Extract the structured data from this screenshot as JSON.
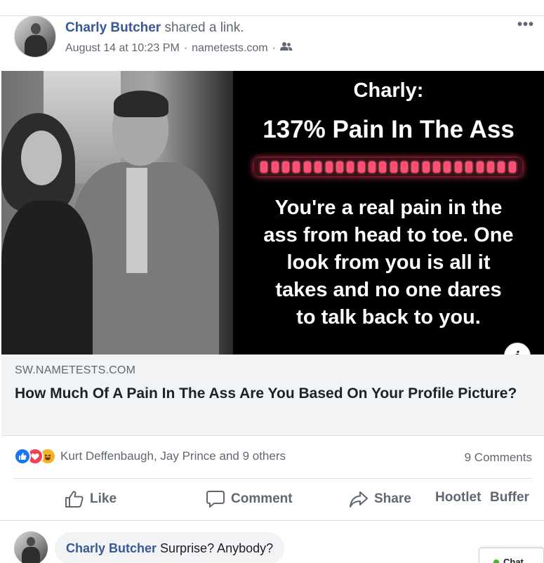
{
  "post": {
    "author": "Charly Butcher",
    "action": "shared a link.",
    "timestamp": "August 14 at 10:23 PM",
    "source": "nametests.com",
    "separator": "·",
    "audience_icon": "friends-icon",
    "menu_label": "•••"
  },
  "preview": {
    "name_line": "Charly:",
    "result_line": "137% Pain In The Ass",
    "meter_level": 1.0,
    "description": "You're a real pain in the\nass from head to toe. One\nlook from you is all it\ntakes and no one dares\nto talk back to you.",
    "info_label": "i"
  },
  "link": {
    "domain": "SW.NAMETESTS.COM",
    "title": "How Much Of A Pain In The Ass Are You Based On Your Profile Picture?"
  },
  "reactions": {
    "icons": [
      "like-reaction-icon",
      "love-reaction-icon",
      "haha-reaction-icon"
    ],
    "names": "Kurt Deffenbaugh, Jay Prince and 9 others",
    "comments": "9 Comments"
  },
  "actions": {
    "like": "Like",
    "comment": "Comment",
    "share": "Share",
    "hootlet": "Hootlet",
    "buffer": "Buffer"
  },
  "comment": {
    "author": "Charly Butcher",
    "text": "Surprise? Anybody?"
  },
  "chat": {
    "label": "Chat"
  },
  "colors": {
    "link_blue": "#385898",
    "like_blue": "#1877f2",
    "love_red": "#f33e58",
    "haha_yellow": "#f7b125",
    "meter_pink": "#ff4f73",
    "online_green": "#42b72a"
  }
}
